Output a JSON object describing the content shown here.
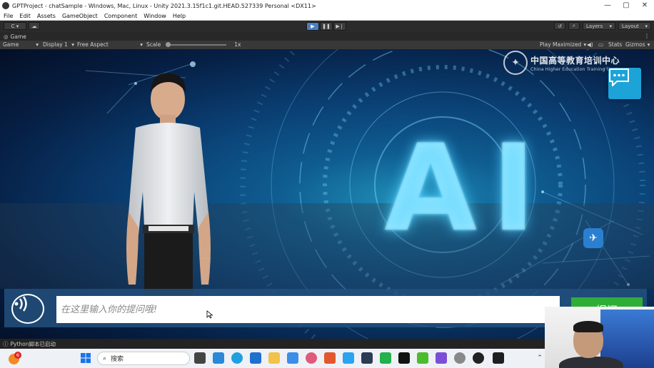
{
  "window": {
    "title": "GPTProject - chatSample - Windows, Mac, Linux - Unity 2021.3.15f1c1.git.HEAD.527339 Personal <DX11>",
    "minimize": "—",
    "maximize": "▢",
    "close": "✕"
  },
  "menu": [
    "File",
    "Edit",
    "Assets",
    "GameObject",
    "Component",
    "Window",
    "Help"
  ],
  "toolbar": {
    "account_label": "C ▾",
    "layers_label": "Layers",
    "layout_label": "Layout"
  },
  "tab": {
    "label": "Game"
  },
  "gamebar": {
    "view": "Game",
    "display": "Display 1",
    "aspect": "Free Aspect",
    "scale_label": "Scale",
    "scale_value": "1x",
    "play_mode": "Play Maximized",
    "stats": "Stats",
    "gizmos": "Gizmos"
  },
  "scene": {
    "logo_cn": "中国高等教育培训中心",
    "logo_en": "China Higher Education Training Center",
    "big_text": "AI",
    "input_placeholder": "在这里输入你的提问哦!",
    "submit_label": "提问"
  },
  "status": {
    "message": "Python脚本已启动"
  },
  "taskbar": {
    "search_placeholder": "搜索",
    "notification_count": "6"
  },
  "colors": {
    "accent": "#1ca4d9",
    "submit": "#2fae37",
    "play_active": "#4a7fc1"
  }
}
